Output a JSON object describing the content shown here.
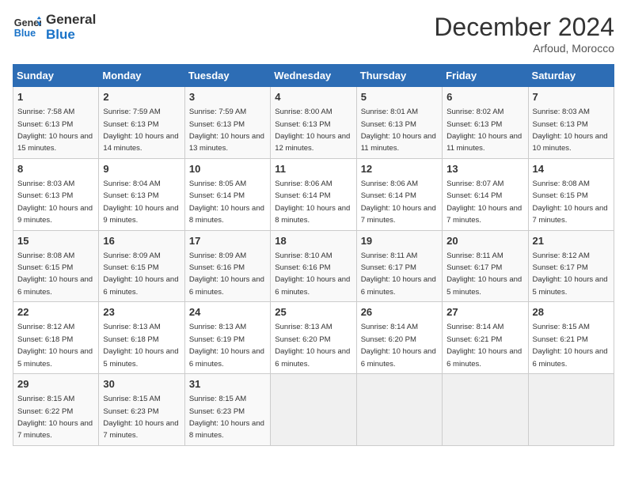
{
  "header": {
    "logo_line1": "General",
    "logo_line2": "Blue",
    "month": "December 2024",
    "location": "Arfoud, Morocco"
  },
  "weekdays": [
    "Sunday",
    "Monday",
    "Tuesday",
    "Wednesday",
    "Thursday",
    "Friday",
    "Saturday"
  ],
  "weeks": [
    [
      {
        "day": "1",
        "rise": "7:58 AM",
        "set": "6:13 PM",
        "daylight": "10 hours and 15 minutes."
      },
      {
        "day": "2",
        "rise": "7:59 AM",
        "set": "6:13 PM",
        "daylight": "10 hours and 14 minutes."
      },
      {
        "day": "3",
        "rise": "7:59 AM",
        "set": "6:13 PM",
        "daylight": "10 hours and 13 minutes."
      },
      {
        "day": "4",
        "rise": "8:00 AM",
        "set": "6:13 PM",
        "daylight": "10 hours and 12 minutes."
      },
      {
        "day": "5",
        "rise": "8:01 AM",
        "set": "6:13 PM",
        "daylight": "10 hours and 11 minutes."
      },
      {
        "day": "6",
        "rise": "8:02 AM",
        "set": "6:13 PM",
        "daylight": "10 hours and 11 minutes."
      },
      {
        "day": "7",
        "rise": "8:03 AM",
        "set": "6:13 PM",
        "daylight": "10 hours and 10 minutes."
      }
    ],
    [
      {
        "day": "8",
        "rise": "8:03 AM",
        "set": "6:13 PM",
        "daylight": "10 hours and 9 minutes."
      },
      {
        "day": "9",
        "rise": "8:04 AM",
        "set": "6:13 PM",
        "daylight": "10 hours and 9 minutes."
      },
      {
        "day": "10",
        "rise": "8:05 AM",
        "set": "6:14 PM",
        "daylight": "10 hours and 8 minutes."
      },
      {
        "day": "11",
        "rise": "8:06 AM",
        "set": "6:14 PM",
        "daylight": "10 hours and 8 minutes."
      },
      {
        "day": "12",
        "rise": "8:06 AM",
        "set": "6:14 PM",
        "daylight": "10 hours and 7 minutes."
      },
      {
        "day": "13",
        "rise": "8:07 AM",
        "set": "6:14 PM",
        "daylight": "10 hours and 7 minutes."
      },
      {
        "day": "14",
        "rise": "8:08 AM",
        "set": "6:15 PM",
        "daylight": "10 hours and 7 minutes."
      }
    ],
    [
      {
        "day": "15",
        "rise": "8:08 AM",
        "set": "6:15 PM",
        "daylight": "10 hours and 6 minutes."
      },
      {
        "day": "16",
        "rise": "8:09 AM",
        "set": "6:15 PM",
        "daylight": "10 hours and 6 minutes."
      },
      {
        "day": "17",
        "rise": "8:09 AM",
        "set": "6:16 PM",
        "daylight": "10 hours and 6 minutes."
      },
      {
        "day": "18",
        "rise": "8:10 AM",
        "set": "6:16 PM",
        "daylight": "10 hours and 6 minutes."
      },
      {
        "day": "19",
        "rise": "8:11 AM",
        "set": "6:17 PM",
        "daylight": "10 hours and 6 minutes."
      },
      {
        "day": "20",
        "rise": "8:11 AM",
        "set": "6:17 PM",
        "daylight": "10 hours and 5 minutes."
      },
      {
        "day": "21",
        "rise": "8:12 AM",
        "set": "6:17 PM",
        "daylight": "10 hours and 5 minutes."
      }
    ],
    [
      {
        "day": "22",
        "rise": "8:12 AM",
        "set": "6:18 PM",
        "daylight": "10 hours and 5 minutes."
      },
      {
        "day": "23",
        "rise": "8:13 AM",
        "set": "6:18 PM",
        "daylight": "10 hours and 5 minutes."
      },
      {
        "day": "24",
        "rise": "8:13 AM",
        "set": "6:19 PM",
        "daylight": "10 hours and 6 minutes."
      },
      {
        "day": "25",
        "rise": "8:13 AM",
        "set": "6:20 PM",
        "daylight": "10 hours and 6 minutes."
      },
      {
        "day": "26",
        "rise": "8:14 AM",
        "set": "6:20 PM",
        "daylight": "10 hours and 6 minutes."
      },
      {
        "day": "27",
        "rise": "8:14 AM",
        "set": "6:21 PM",
        "daylight": "10 hours and 6 minutes."
      },
      {
        "day": "28",
        "rise": "8:15 AM",
        "set": "6:21 PM",
        "daylight": "10 hours and 6 minutes."
      }
    ],
    [
      {
        "day": "29",
        "rise": "8:15 AM",
        "set": "6:22 PM",
        "daylight": "10 hours and 7 minutes."
      },
      {
        "day": "30",
        "rise": "8:15 AM",
        "set": "6:23 PM",
        "daylight": "10 hours and 7 minutes."
      },
      {
        "day": "31",
        "rise": "8:15 AM",
        "set": "6:23 PM",
        "daylight": "10 hours and 8 minutes."
      },
      null,
      null,
      null,
      null
    ]
  ]
}
